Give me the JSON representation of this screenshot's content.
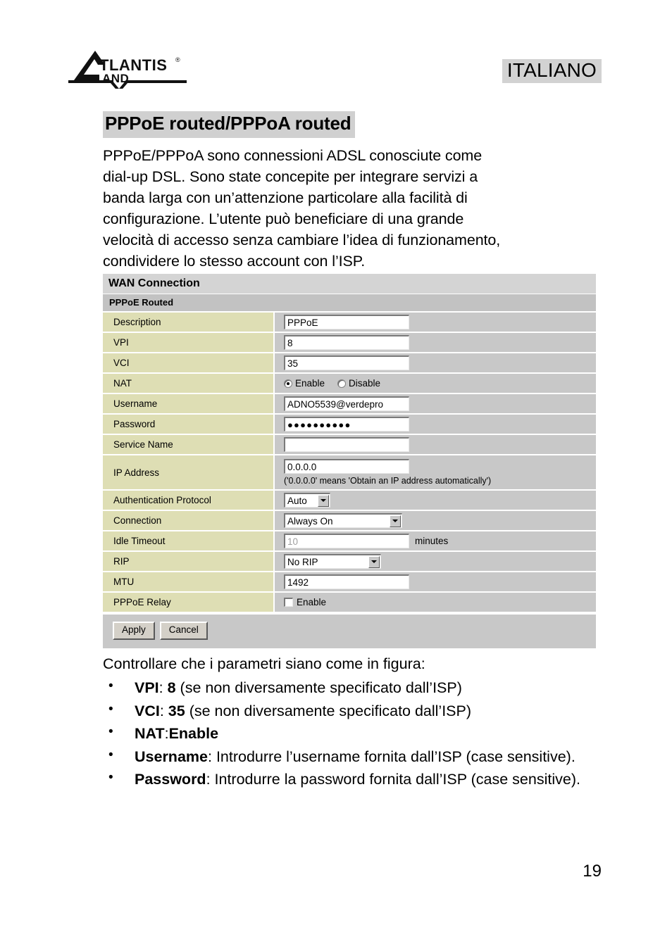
{
  "header": {
    "logo_brand": "ATLANTIS",
    "logo_sub": "LAND",
    "language_badge": "ITALIANO"
  },
  "section": {
    "title": "PPPoE routed/PPPoA routed",
    "intro_lines": [
      "PPPoE/PPPoA sono connessioni ADSL conosciute come",
      "dial-up DSL. Sono state concepite per integrare servizi a",
      "banda larga con un’attenzione particolare alla facilità di",
      "configurazione. L’utente   può beneficiare di una grande",
      "velocità di accesso senza cambiare l’idea di funzionamento,",
      "condividere lo stesso account con l’ISP."
    ]
  },
  "screenshot": {
    "title": "WAN Connection",
    "subtitle": "PPPoE Routed",
    "rows": {
      "description": {
        "label": "Description",
        "value": "PPPoE"
      },
      "vpi": {
        "label": "VPI",
        "value": "8"
      },
      "vci": {
        "label": "VCI",
        "value": "35"
      },
      "nat": {
        "label": "NAT",
        "enable_label": "Enable",
        "disable_label": "Disable",
        "selected": "Enable"
      },
      "username": {
        "label": "Username",
        "value": "ADNO5539@verdepro"
      },
      "password": {
        "label": "Password",
        "value": "●●●●●●●●●●"
      },
      "service_name": {
        "label": "Service Name",
        "value": ""
      },
      "ip_address": {
        "label": "IP Address",
        "value": "0.0.0.0",
        "hint": "('0.0.0.0' means 'Obtain an IP address automatically')"
      },
      "auth_protocol": {
        "label": "Authentication Protocol",
        "value": "Auto"
      },
      "connection": {
        "label": "Connection",
        "value": "Always On"
      },
      "idle_timeout": {
        "label": "Idle Timeout",
        "value": "10",
        "unit": "minutes"
      },
      "rip": {
        "label": "RIP",
        "value": "No RIP"
      },
      "mtu": {
        "label": "MTU",
        "value": "1492"
      },
      "pppoe_relay": {
        "label": "PPPoE Relay",
        "enable_label": "Enable",
        "checked": false
      }
    },
    "buttons": {
      "apply": "Apply",
      "cancel": "Cancel"
    }
  },
  "after": {
    "lead": "Controllare che i parametri siano come in figura:",
    "items": [
      {
        "bold": "VPI",
        "sep": ": ",
        "bold2": "8",
        "rest": " (se non diversamente specificato dall’ISP)"
      },
      {
        "bold": "VCI",
        "sep": ": ",
        "bold2": "35",
        "rest": " (se non diversamente specificato dall’ISP)"
      },
      {
        "bold": "NAT",
        "sep": ":",
        "bold2": "Enable",
        "rest": ""
      },
      {
        "bold": "Username",
        "sep": ": ",
        "bold2": "",
        "rest": "Introdurre l’username fornita dall’ISP (case sensitive)."
      },
      {
        "bold": "Password",
        "sep": ": ",
        "bold2": "",
        "rest": "Introdurre la password fornita dall’ISP (case sensitive)."
      }
    ]
  },
  "footer": {
    "page_number": "19"
  }
}
